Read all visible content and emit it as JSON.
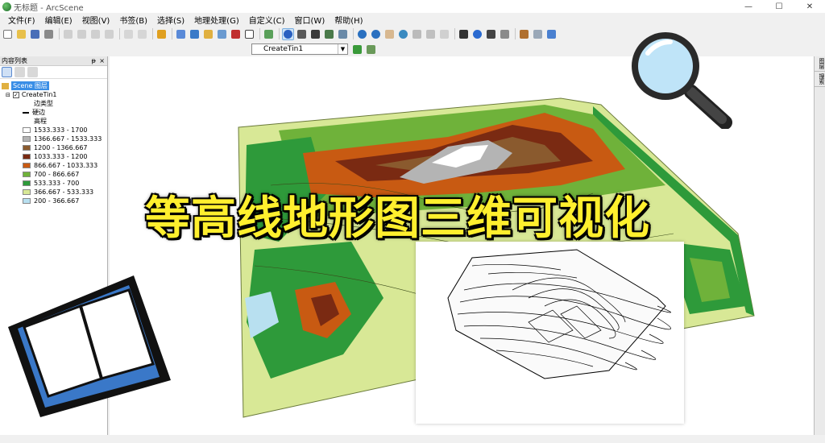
{
  "window": {
    "title": "无标题 - ArcScene"
  },
  "menu": [
    "文件(F)",
    "编辑(E)",
    "视图(V)",
    "书签(B)",
    "选择(S)",
    "地理处理(G)",
    "自定义(C)",
    "窗口(W)",
    "帮助(H)"
  ],
  "toolbar": {
    "layer_select_value": "CreateTin1"
  },
  "toc": {
    "title": "内容列表",
    "scene_label": "Scene 图层",
    "layer_name": "CreateTin1",
    "edge_type_label": "边类型",
    "hard_edge_label": "硬边",
    "elevation_label": "高程",
    "legend": [
      {
        "label": "1533.333 - 1700",
        "color": "#ffffff"
      },
      {
        "label": "1366.667 - 1533.333",
        "color": "#b4b4b4"
      },
      {
        "label": "1200 - 1366.667",
        "color": "#8a5a2e"
      },
      {
        "label": "1033.333 - 1200",
        "color": "#7a2a12"
      },
      {
        "label": "866.667 - 1033.333",
        "color": "#c85a12"
      },
      {
        "label": "700 - 866.667",
        "color": "#6fb23a"
      },
      {
        "label": "533.333 - 700",
        "color": "#2e9a3a"
      },
      {
        "label": "366.667 - 533.333",
        "color": "#d8e896"
      },
      {
        "label": "200 - 366.667",
        "color": "#b8e0f0"
      }
    ]
  },
  "overlay": {
    "title": "等高线地形图三维可视化"
  },
  "dock": {
    "tab1": "图层",
    "tab2": "搜索"
  }
}
